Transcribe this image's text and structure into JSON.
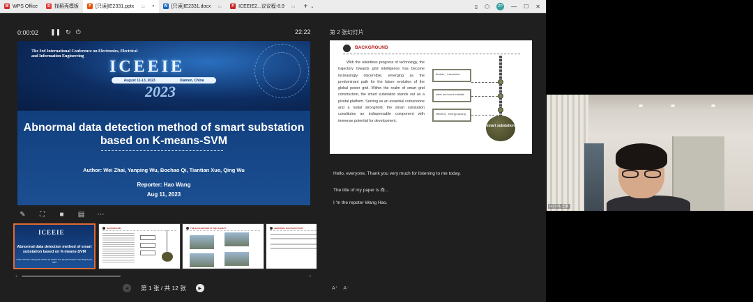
{
  "titlebar": {
    "tabs": [
      {
        "label": "WPS Office",
        "color": "#d32f2f",
        "icon": "wps-logo-icon"
      },
      {
        "label": "找稻壳模板",
        "color": "#e53935",
        "icon": "docer-icon"
      },
      {
        "label": "[只读]IE2331.pptx",
        "color": "#e65100",
        "icon": "pptx-icon",
        "active": true
      },
      {
        "label": "[只读]IE2331.docx",
        "color": "#1565c0",
        "icon": "docx-icon"
      },
      {
        "label": "ICEEIE2...议议程-8.9",
        "color": "#c62828",
        "icon": "pdf-icon"
      }
    ],
    "add_tab": "+",
    "avatar_text": "ZP"
  },
  "presenter": {
    "elapsed": "0:00:02",
    "clock": "22:22",
    "next_label": "第 2 张幻灯片",
    "pager_text": "第 1 张 / 共 12 张"
  },
  "current_slide": {
    "conference": "The 3rd International Conference on Electronics, Electrical and Information Engineering",
    "logo": "ICEEIE",
    "date_left": "August 11-13, 2023",
    "date_right": "Xiamen, China",
    "year": "2023",
    "title": "Abnormal data detection method of smart substation based on K-means-SVM",
    "authors": "Author:  Wei Zhai, Yanping Wu, Bochao Qi, Tiantian Xue, Qing Wu",
    "reporter": "Reporter: Hao Wang",
    "date": "Aug 11, 2023"
  },
  "next_slide": {
    "heading": "BACKGROUND",
    "body": "With the relentless progress of technology, the trajectory towards grid intelligence has become increasingly discernible, emerging as the predominant path for the future evolution of the global power grid. Within the realm of smart grid construction, the smart substation stands out as a pivotal platform. Serving as an essential cornerstone and a nodal stronghold, the smart substation constitutes an indispensable component with immense potential for development.",
    "boxes": [
      "flexible、interactive",
      "safer and more reliable",
      "efficient、energy-saving"
    ],
    "ball": "smart substation"
  },
  "notes": [
    "Hello, everyone. Thank you very much for listening to me today.",
    "The title of my paper is 命...",
    "I   'm the repoter Wang Hao."
  ],
  "thumbnails": [
    {
      "logo": "ICEEIE",
      "title": "Abnormal data detection method of smart substation based on K-means-SVM",
      "sub": "Author: Wei Zhai, Yanping Wu, Bochao Qi, Tiantian Xue, Qing Wu  Reporter: Hao Wang  Aug 11, 2023"
    },
    {
      "heading": "BACKGROUND"
    },
    {
      "heading": "THE BACKGROUND OF THE SUBJECT"
    },
    {
      "heading": "ABNORMAL DATA DETECTION"
    }
  ],
  "webcam": {
    "name": "IE2331-王豪"
  }
}
